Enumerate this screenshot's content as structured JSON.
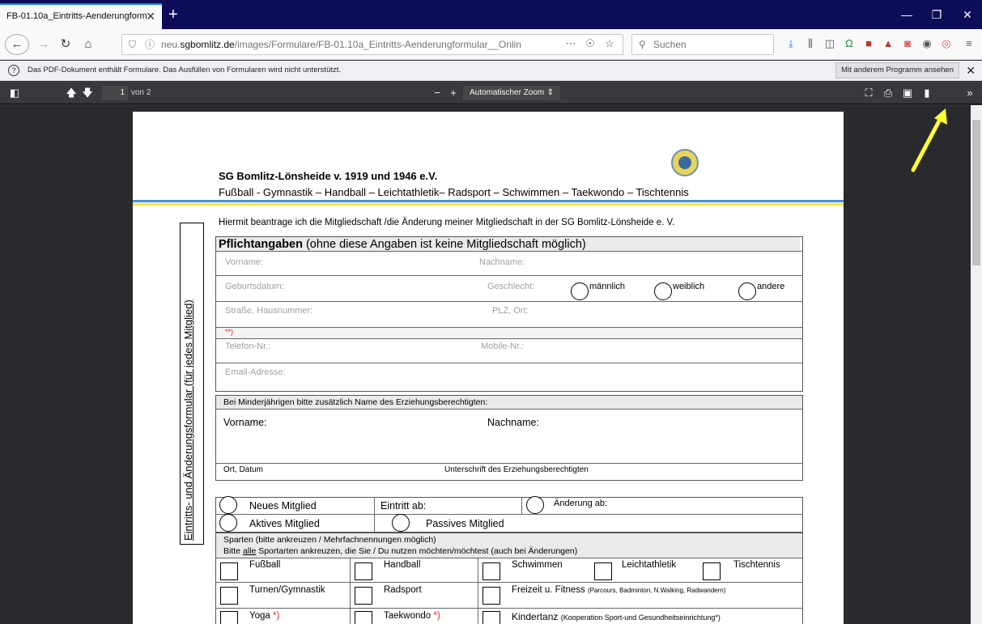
{
  "browser": {
    "tab_title": "FB-01.10a_Eintritts-Aenderungform",
    "url_prefix": "neu.",
    "url_domain": "sgbomlitz.de",
    "url_path": "/images/Formulare/FB-01.10a_Eintritts-Aenderungformular__Onlin",
    "search_placeholder": "Suchen",
    "notification": "Das PDF-Dokument enthält Formulare. Das Ausfüllen von Formularen wird nicht unterstützt.",
    "open_other_button": "Mit anderem Programm ansehen"
  },
  "pdf_toolbar": {
    "page_number": "1",
    "page_count": "von 2",
    "zoom": "Automatischer Zoom"
  },
  "document": {
    "club_name": "SG Bomlitz-Lönsheide v. 1919 und 1946 e.V.",
    "club_sports": "Fußball - Gymnastik – Handball – Leichtathletik– Radsport – Schwimmen – Taekwondo – Tischtennis",
    "vertical_title": "Eintritts- und Änderungsformular (für jedes Mitglied)",
    "intro": "Hiermit beantrage ich die Mitgliedschaft /die Änderung meiner Mitgliedschaft in der SG Bomlitz-Lönsheide e. V.",
    "mandatory_title_bold": "Pflichtangaben",
    "mandatory_title_rest": "(ohne diese Angaben ist keine Mitgliedschaft möglich)",
    "fields": {
      "vorname": "Vorname:",
      "nachname": "Nachname:",
      "geburtsdatum": "Geburtsdatum:",
      "geschlecht": "Geschlecht:",
      "maennlich": "männlich",
      "weiblich": "weiblich",
      "andere": "andere",
      "strasse": "Straße, Hausnummer:",
      "plz_ort": "PLZ, Ort:",
      "stars": "**)",
      "telefon": "Telefon-Nr.:",
      "mobile": "Mobile-Nr.:",
      "email": "Email-Adresse:"
    },
    "guardian": {
      "header": "Bei Minderjährigen bitte zusätzlich Name des Erziehungsberechtigten:",
      "vorname": "Vorname:",
      "nachname": "Nachname:",
      "ort_datum": "Ort, Datum",
      "unterschrift": "Unterschrift des Erziehungsberechtigten"
    },
    "membership": {
      "neues": "Neues Mitglied",
      "eintritt": "Eintritt ab:",
      "aenderung": "Änderung ab:",
      "aktives": "Aktives Mitglied",
      "passives": "Passives Mitglied"
    },
    "sparten": {
      "header1": "Sparten (bitte ankreuzen / Mehrfachnennungen möglich)",
      "header2_pre": "Bitte ",
      "header2_u": "alle",
      "header2_post": " Sportarten ankreuzen, die Sie / Du nutzen möchten/möchtest (auch bei Änderungen)",
      "fussball": "Fußball",
      "handball": "Handball",
      "schwimmen": "Schwimmen",
      "leichtathletik": "Leichtathletik",
      "tischtennis": "Tischtennis",
      "turnen": "Turnen/Gymnastik",
      "radsport": "Radsport",
      "freizeit": "Freizeit u. Fitness",
      "freizeit_note": "(Parcours, Badminton, N.Walking, Radwandern)",
      "yoga": "Yoga",
      "taekwondo": "Taekwondo",
      "star": "*)",
      "kindertanz": "Kindertanz",
      "kindertanz_note": "(Kooperation Sport-und Gesundheitseinrichtung*)"
    }
  },
  "colors": {
    "titlebar": "#0c0c58",
    "viewer_bg": "#2a2a2e",
    "arrow": "#ffff33"
  }
}
